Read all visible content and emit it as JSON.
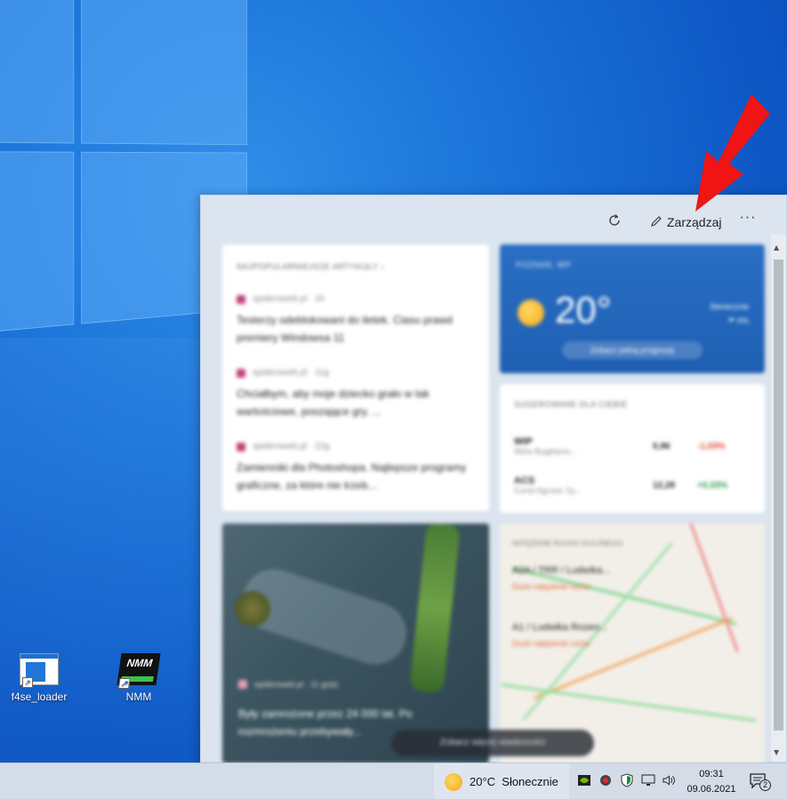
{
  "desktop": {
    "icons": [
      {
        "label": "f4se_loader",
        "icon": "f4se-app-icon"
      },
      {
        "label": "NMM",
        "icon": "nmm-app-icon",
        "badge_text": "NMM"
      }
    ]
  },
  "widgets": {
    "manage_label": "Zarządzaj",
    "more_label": "···",
    "news": {
      "header": "NAJPOPULARNIEJSZE ARTYKUŁY ›",
      "items": [
        {
          "source": "spidersweb.pl · 1h",
          "title": "Testerzy odeblokowani do iletek. Ciasu prawd premiery Windowsa 11"
        },
        {
          "source": "spidersweb.pl · 11g",
          "title": "Chciałbym, aby moje dziecko grało w tak wartościowe, poszające gry. ..."
        },
        {
          "source": "spidersweb.pl · 22g",
          "title": "Zamienniki dla Photoshopa. Najlepsze programy graficzne, za które nie trzeb..."
        }
      ]
    },
    "weather": {
      "header": "POZNAŃ, WP",
      "temperature": "20°",
      "side_line1": "Słonecznie",
      "side_line2": "☂ 0%",
      "link": "Zobacz pełną prognozę"
    },
    "stocks": {
      "header": "SUGEROWANE DLA CIEBIE",
      "rows": [
        {
          "symbol": "WIP",
          "name": "Wirtu Bugiliamo...",
          "value": "0,96",
          "change": "-1,03%",
          "color": "#d9442e"
        },
        {
          "symbol": "ACS",
          "name": "Cursit Agrosic Sy...",
          "value": "12,28",
          "change": "+0,33%",
          "color": "#1f9a4a"
        }
      ]
    },
    "photo_article": {
      "source": "spidersweb.pl · 11 godz.",
      "title": "Były zamrożone przez 24 000 lat. Po rozmrożeniu przebywały..."
    },
    "traffic": {
      "header": "NATĘŻENIE RUCHU ULICZNEGO",
      "route1": "A2A / TRR / Ludwika...",
      "route1_status": "Duże natężenie ruchu",
      "route2": "A1 / Ludwika Rozen...",
      "route2_status": "Duże natężenie ruchu"
    },
    "more_news": "Zobacz więcej wiadomości"
  },
  "taskbar": {
    "weather_text": "20°C  Słonecznie",
    "time": "09:31",
    "date": "09.06.2021",
    "notification_count": "2"
  },
  "colors": {
    "annotation_arrow": "#f01414",
    "desktop_blue": "#1a72d8",
    "weather_card": "#2a6fc4"
  }
}
